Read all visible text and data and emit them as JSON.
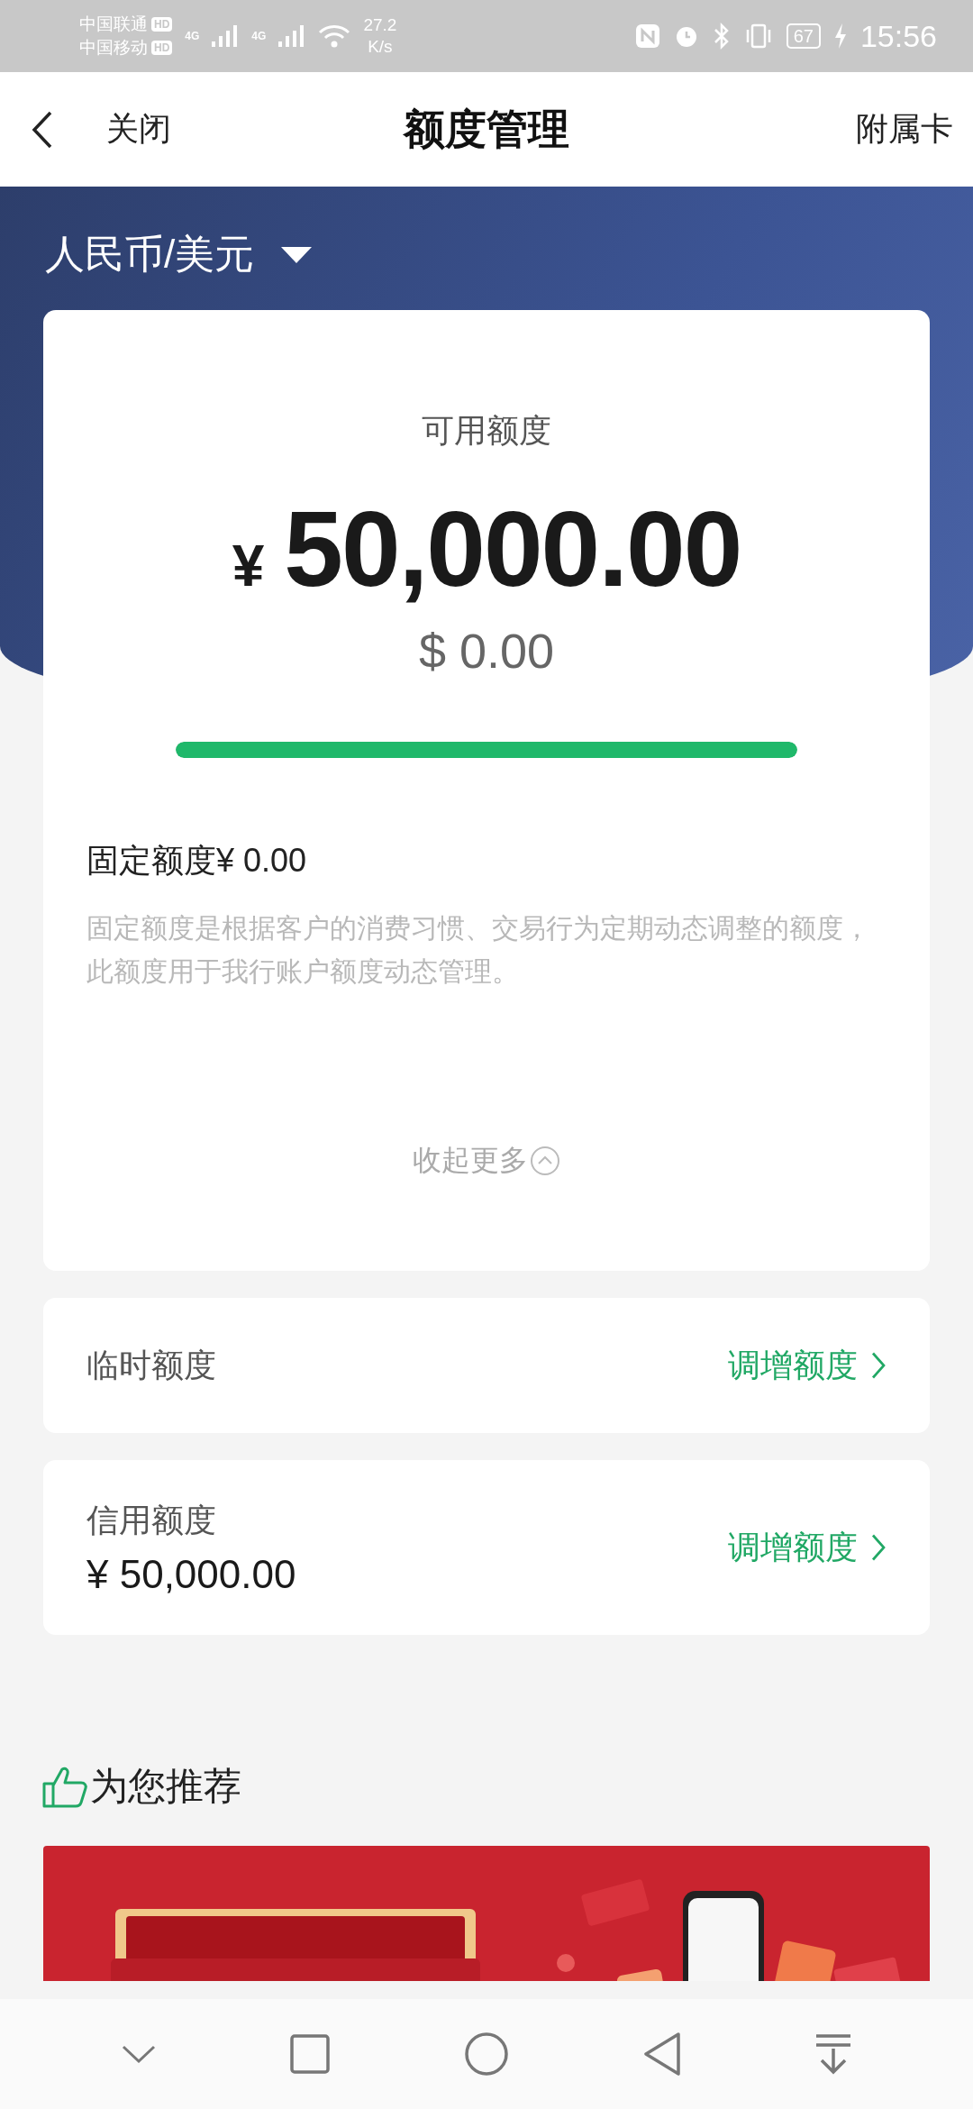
{
  "status_bar": {
    "carrier_1": "中国联通",
    "carrier_1_badge": "HD",
    "carrier_2": "中国移动",
    "carrier_2_badge": "HD",
    "network_1": "4G",
    "network_2": "4G",
    "speed": "27.2",
    "speed_unit": "K/s",
    "battery": "67",
    "time": "15:56"
  },
  "header": {
    "close": "关闭",
    "title": "额度管理",
    "right": "附属卡"
  },
  "currency_selector": "人民币/美元",
  "available": {
    "label": "可用额度",
    "amount_symbol": "¥",
    "amount": "50,000.00",
    "usd": "$ 0.00",
    "level": 1
  },
  "fixed": {
    "label": "固定额度",
    "value": "¥ 0.00",
    "description": "固定额度是根据客户的消费习惯、交易行为定期动态调整的额度，此额度用于我行账户额度动态管理。",
    "toggle": "收起更多",
    "expanded": true
  },
  "limits": [
    {
      "label": "临时额度",
      "action": "调增额度"
    },
    {
      "label": "信用额度",
      "value": "¥ 50,000.00",
      "action": "调增额度"
    }
  ],
  "recommend": {
    "title": "为您推荐"
  }
}
